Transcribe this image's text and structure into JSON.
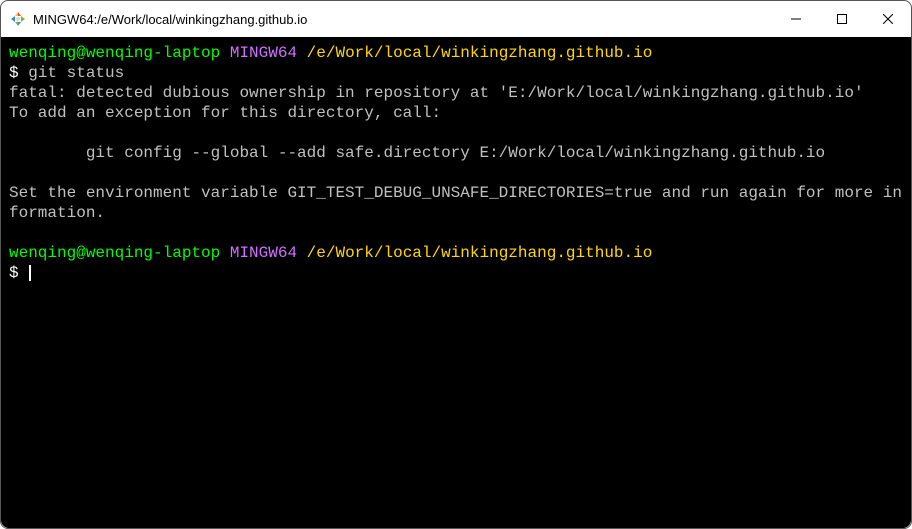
{
  "window": {
    "title": "MINGW64:/e/Work/local/winkingzhang.github.io"
  },
  "terminal": {
    "prompt1": {
      "user": "wenqing@wenqing-laptop",
      "env": "MINGW64",
      "path": "/e/Work/local/winkingzhang.github.io"
    },
    "command1": {
      "symbol": "$",
      "text": "git status"
    },
    "output": {
      "line1": "fatal: detected dubious ownership in repository at 'E:/Work/local/winkingzhang.github.io'",
      "line2": "To add an exception for this directory, call:",
      "line3": "        git config --global --add safe.directory E:/Work/local/winkingzhang.github.io",
      "line4": "Set the environment variable GIT_TEST_DEBUG_UNSAFE_DIRECTORIES=true and run again for more information."
    },
    "prompt2": {
      "user": "wenqing@wenqing-laptop",
      "env": "MINGW64",
      "path": "/e/Work/local/winkingzhang.github.io"
    },
    "command2": {
      "symbol": "$"
    }
  }
}
